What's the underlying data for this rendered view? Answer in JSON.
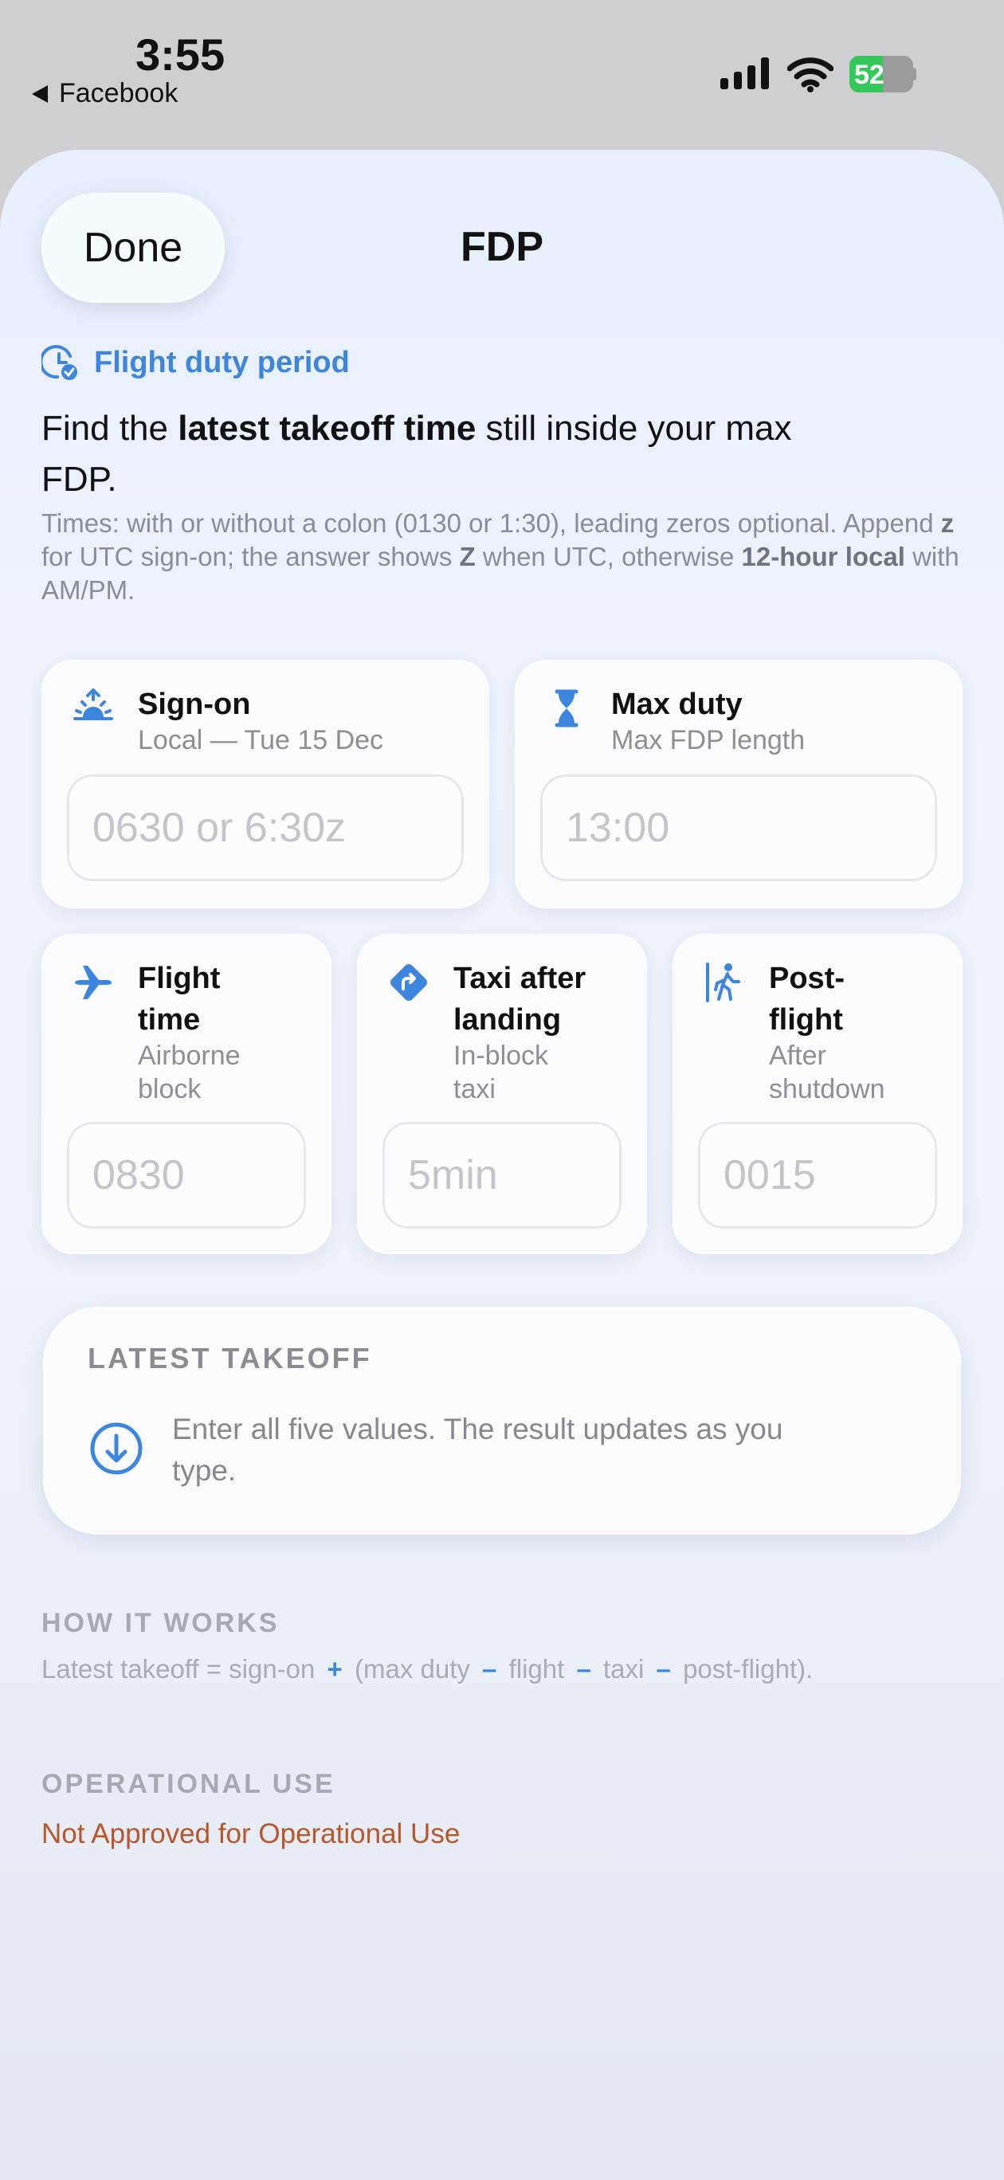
{
  "status_bar": {
    "time": "3:55",
    "back_app": "Facebook",
    "battery_percent": "52",
    "battery_level": 0.52
  },
  "header": {
    "done_label": "Done",
    "title": "FDP"
  },
  "section": {
    "tag": "Flight duty period",
    "intro_before": "Find the ",
    "intro_bold": "latest takeoff time",
    "intro_after": " still inside your max FDP.",
    "hint_1": "Times: with or without a colon (0130 or 1:30), leading zeros optional. Append ",
    "hint_z": "z",
    "hint_2": " for UTC sign-on; the answer shows ",
    "hint_Z": "Z",
    "hint_3": " when UTC, otherwise ",
    "hint_local": "12-hour local",
    "hint_4": " with AM/PM."
  },
  "inputs": {
    "sign_on": {
      "title": "Sign-on",
      "subtitle": "Local — Tue 15 Dec",
      "placeholder": "0630 or 6:30z",
      "icon": "sunrise-icon"
    },
    "max_duty": {
      "title": "Max duty",
      "subtitle": "Max FDP length",
      "placeholder": "13:00",
      "icon": "hourglass-icon"
    },
    "flight_time": {
      "title_1": "Flight",
      "title_2": "time",
      "subtitle_1": "Airborne",
      "subtitle_2": "block",
      "placeholder": "0830",
      "icon": "airplane-icon"
    },
    "taxi": {
      "title_1": "Taxi after",
      "title_2": "landing",
      "subtitle_1": "In-block",
      "subtitle_2": "taxi",
      "placeholder": "5min",
      "icon": "turn-sign-icon"
    },
    "post_flight": {
      "title_1": "Post-",
      "title_2": "flight",
      "subtitle_1": "After",
      "subtitle_2": "shutdown",
      "placeholder": "0015",
      "icon": "exit-walk-icon"
    }
  },
  "result": {
    "label": "LATEST TAKEOFF",
    "message": "Enter all five values. The result updates as you type."
  },
  "how_it_works": {
    "label": "HOW IT WORKS",
    "part_1": "Latest takeoff = sign-on",
    "plus": "+",
    "part_2": "(max duty",
    "minus": "–",
    "part_3": "flight",
    "part_4": "taxi",
    "part_5": "post-flight)."
  },
  "operational": {
    "label": "OPERATIONAL USE",
    "text": "Not Approved for Operational Use"
  },
  "colors": {
    "accent": "#3d86e0",
    "warning": "#b9572a",
    "battery_green": "#34c759"
  }
}
